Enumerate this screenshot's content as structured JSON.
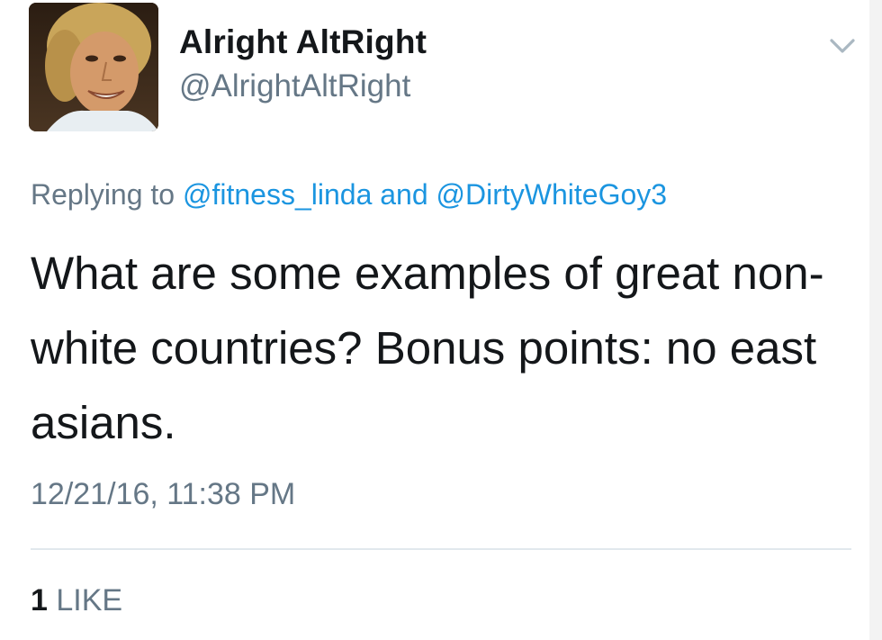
{
  "tweet": {
    "display_name": "Alright AltRight",
    "handle": "@AlrightAltRight",
    "menu_icon": "chevron-down-icon",
    "reply": {
      "prefix": "Replying to",
      "mention_1": "@fitness_linda",
      "conjunction": "and",
      "mention_2": "@DirtyWhiteGoy3"
    },
    "text": "What are some examples of great non-white countries? Bonus points: no east asians.",
    "timestamp": "12/21/16, 11:38 PM",
    "likes": {
      "count": "1",
      "label": "LIKE"
    }
  },
  "colors": {
    "text": "#14171a",
    "secondary": "#657786",
    "link": "#1b95e0",
    "divider": "#e1e8ed"
  }
}
